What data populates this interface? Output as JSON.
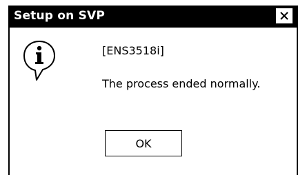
{
  "window": {
    "title": "Setup on SVP",
    "close_icon": "close-icon"
  },
  "message": {
    "icon": "info-icon",
    "code": "[ENS3518i]",
    "text": "The process ended normally."
  },
  "buttons": {
    "ok_label": "OK"
  },
  "colors": {
    "titlebar_bg": "#000000",
    "titlebar_text": "#ffffff",
    "dialog_bg": "#ffffff",
    "text": "#000000"
  }
}
